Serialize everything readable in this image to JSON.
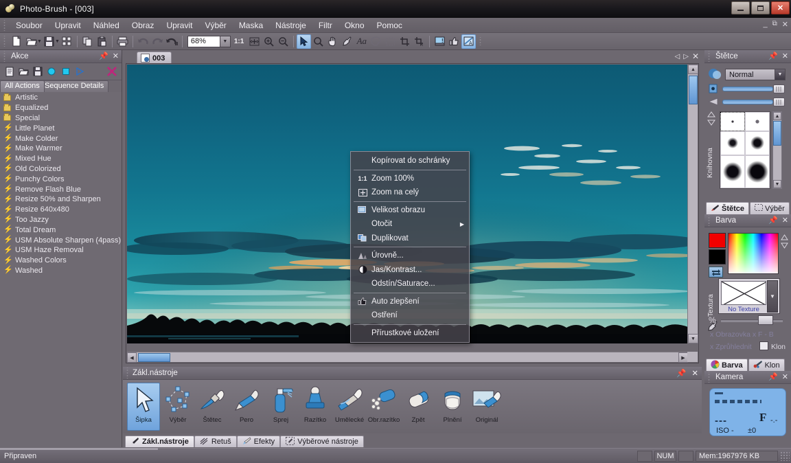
{
  "window": {
    "title": "Photo-Brush - [003]",
    "minimize": "—",
    "maximize": "❐",
    "close": "✕",
    "mdi_minimize": "_",
    "mdi_restore": "❐",
    "mdi_close": "✕"
  },
  "menubar": {
    "items": [
      {
        "label": "Soubor"
      },
      {
        "label": "Upravit"
      },
      {
        "label": "Náhled"
      },
      {
        "label": "Obraz"
      },
      {
        "label": "Upravit"
      },
      {
        "label": "Výběr"
      },
      {
        "label": "Maska"
      },
      {
        "label": "Nástroje"
      },
      {
        "label": "Filtr"
      },
      {
        "label": "Okno"
      },
      {
        "label": "Pomoc"
      }
    ]
  },
  "toolbar": {
    "zoom_value": "68%",
    "ratio_label": "1:1",
    "buttons": [
      {
        "name": "new-document-icon"
      },
      {
        "name": "open-file-icon"
      },
      {
        "name": "save-file-icon"
      },
      {
        "name": "thumbnails-icon"
      },
      {
        "name": "copy-icon"
      },
      {
        "name": "paste-icon"
      },
      {
        "name": "print-icon"
      },
      {
        "name": "undo-icon"
      },
      {
        "name": "redo-icon"
      },
      {
        "name": "undo-history-icon"
      },
      {
        "name": "zoom-fit-icon"
      },
      {
        "name": "zoom-in-icon"
      },
      {
        "name": "zoom-out-icon"
      },
      {
        "name": "pointer-tool-icon"
      },
      {
        "name": "magnifier-tool-icon"
      },
      {
        "name": "hand-tool-icon"
      },
      {
        "name": "eyedropper-tool-icon"
      },
      {
        "name": "text-tool-icon"
      },
      {
        "name": "palette-icon"
      },
      {
        "name": "marquee-icon"
      },
      {
        "name": "crop-icon"
      },
      {
        "name": "crop-rotate-icon"
      },
      {
        "name": "screen-capture-icon"
      },
      {
        "name": "auto-enhance-icon"
      },
      {
        "name": "effects-icon"
      }
    ]
  },
  "left_panel": {
    "title": "Akce",
    "pin": "▮",
    "close": "✕",
    "toolbar_icons": [
      "new-action-icon",
      "open-action-icon",
      "save-action-icon",
      "record-icon",
      "stop-icon",
      "play-icon",
      "delete-icon"
    ],
    "tabs": [
      {
        "label": "All Actions",
        "selected": true
      },
      {
        "label": "Sequence Details",
        "selected": false
      }
    ],
    "items": [
      {
        "label": "Artistic",
        "type": "folder"
      },
      {
        "label": "Equalized",
        "type": "folder"
      },
      {
        "label": "Special",
        "type": "folder"
      },
      {
        "label": "Little Planet",
        "type": "action"
      },
      {
        "label": "Make Colder",
        "type": "action"
      },
      {
        "label": "Make Warmer",
        "type": "action"
      },
      {
        "label": "Mixed Hue",
        "type": "action"
      },
      {
        "label": "Old Colorized",
        "type": "action"
      },
      {
        "label": "Punchy Colors",
        "type": "action"
      },
      {
        "label": "Remove Flash Blue",
        "type": "action"
      },
      {
        "label": "Resize 50% and Sharpen",
        "type": "action"
      },
      {
        "label": "Resize 640x480",
        "type": "action"
      },
      {
        "label": "Too Jazzy",
        "type": "action"
      },
      {
        "label": "Total Dream",
        "type": "action"
      },
      {
        "label": "USM Absolute Sharpen (4pass)",
        "type": "action"
      },
      {
        "label": "USM Haze Removal",
        "type": "action"
      },
      {
        "label": "Washed Colors",
        "type": "action"
      },
      {
        "label": "Washed",
        "type": "action"
      }
    ]
  },
  "document": {
    "tab_label": "003",
    "nav_prev": "◁",
    "nav_next": "▷",
    "nav_close": "✕"
  },
  "context_menu": {
    "items": [
      {
        "label": "Kopírovat do schránky",
        "icon": "",
        "submenu": false,
        "sep_after": true
      },
      {
        "label": "Zoom 100%",
        "icon": "1:1",
        "submenu": false,
        "sep_after": false
      },
      {
        "label": "Zoom na celý",
        "icon": "zoom-fit-icon",
        "submenu": false,
        "sep_after": true
      },
      {
        "label": "Velikost obrazu",
        "icon": "image-size-icon",
        "submenu": false,
        "sep_after": false
      },
      {
        "label": "Otočit",
        "icon": "",
        "submenu": true,
        "sep_after": false
      },
      {
        "label": "Duplikovat",
        "icon": "duplicate-icon",
        "submenu": false,
        "sep_after": true
      },
      {
        "label": "Úrovně...",
        "icon": "levels-icon",
        "submenu": false,
        "sep_after": false
      },
      {
        "label": "Jas/Kontrast...",
        "icon": "brightness-icon",
        "submenu": false,
        "sep_after": false
      },
      {
        "label": "Odstín/Saturace...",
        "icon": "",
        "submenu": false,
        "sep_after": true
      },
      {
        "label": "Auto zlepšení",
        "icon": "auto-enhance-icon",
        "submenu": false,
        "sep_after": false
      },
      {
        "label": "Ostření",
        "icon": "",
        "submenu": false,
        "sep_after": true
      },
      {
        "label": "Přírustkové uložení",
        "icon": "",
        "submenu": false,
        "sep_after": false
      }
    ]
  },
  "tools_panel": {
    "title": "Zákl.nástroje",
    "pin": "▮",
    "close": "✕",
    "tools": [
      {
        "label": "Šipka",
        "icon": "arrow-tool-icon",
        "selected": true
      },
      {
        "label": "Výběr",
        "icon": "lasso-tool-icon",
        "selected": false
      },
      {
        "label": "Štětec",
        "icon": "brush-tool-icon",
        "selected": false
      },
      {
        "label": "Pero",
        "icon": "pen-tool-icon",
        "selected": false
      },
      {
        "label": "Sprej",
        "icon": "spray-tool-icon",
        "selected": false
      },
      {
        "label": "Razítko",
        "icon": "stamp-tool-icon",
        "selected": false
      },
      {
        "label": "Umělecké",
        "icon": "artistic-tool-icon",
        "selected": false
      },
      {
        "label": "Obr.razítko",
        "icon": "image-stamp-tool-icon",
        "selected": false
      },
      {
        "label": "Zpět",
        "icon": "eraser-tool-icon",
        "selected": false
      },
      {
        "label": "Plnění",
        "icon": "fill-tool-icon",
        "selected": false
      },
      {
        "label": "Originál",
        "icon": "original-tool-icon",
        "selected": false
      }
    ],
    "tabs": [
      {
        "label": "Zákl.nástroje",
        "icon": "brush-tab-icon",
        "selected": true
      },
      {
        "label": "Retuš",
        "icon": "retouch-tab-icon",
        "selected": false
      },
      {
        "label": "Efekty",
        "icon": "effects-tab-icon",
        "selected": false
      },
      {
        "label": "Výběrové nástroje",
        "icon": "selection-tab-icon",
        "selected": false
      }
    ]
  },
  "brush_panel": {
    "title": "Štětce",
    "pin": "▮",
    "close": "✕",
    "blend_mode": "Normal",
    "library_label": "Knihovna",
    "tabs": [
      {
        "label": "Štětce",
        "icon": "brush-tab-icon",
        "selected": true
      },
      {
        "label": "Výběr",
        "icon": "selection-tab-icon",
        "selected": false
      }
    ]
  },
  "color_panel": {
    "title": "Barva",
    "pin": "▮",
    "close": "✕",
    "foreground_color": "#f20000",
    "background_color": "#000000",
    "texture_label": "Textura",
    "texture_value": "No Texture",
    "percent_label": "%",
    "screen_label": "x Obrazovka  x   F - B",
    "transparent_label": "x Zprůhlednit",
    "clone_label": "Klon",
    "tabs": [
      {
        "label": "Barva",
        "icon": "color-wheel-icon",
        "selected": true
      },
      {
        "label": "Klon",
        "icon": "clone-icon",
        "selected": false
      }
    ]
  },
  "camera_panel": {
    "title": "Kamera",
    "pin": "▮",
    "close": "✕",
    "display_dashes": "---",
    "aperture": "F",
    "aperture_value": "-.-",
    "iso_label": "ISO -",
    "exposure_comp": "±0"
  },
  "statusbar": {
    "message": "Připraven",
    "cell_blank1": "",
    "num_indicator": "NUM",
    "cell_blank2": "",
    "memory": "Mem:1967976 KB"
  },
  "watermark": {
    "text": ""
  }
}
